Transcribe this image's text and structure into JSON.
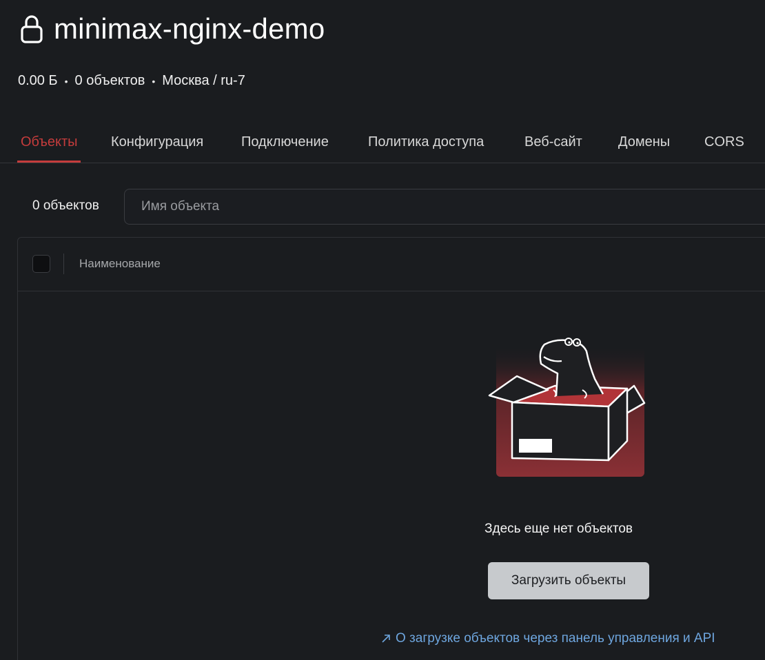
{
  "bucket": {
    "title": "minimax-nginx-demo",
    "size": "0.00 Б",
    "objects": "0 объектов",
    "location": "Москва / ru-7",
    "separator": "•"
  },
  "tabs": [
    {
      "label": "Объекты",
      "active": true
    },
    {
      "label": "Конфигурация",
      "active": false
    },
    {
      "label": "Подключение",
      "active": false
    },
    {
      "label": "Политика доступа",
      "active": false
    },
    {
      "label": "Веб-сайт",
      "active": false
    },
    {
      "label": "Домены",
      "active": false
    },
    {
      "label": "CORS",
      "active": false
    }
  ],
  "toolbar": {
    "count": "0 объектов",
    "search_placeholder": "Имя объекта"
  },
  "table": {
    "columns": [
      "Наименование"
    ]
  },
  "empty_state": {
    "message": "Здесь еще нет объектов",
    "upload_button": "Загрузить объекты",
    "help_link": "О загрузке объектов через панель управления и API"
  },
  "colors": {
    "accent": "#c53c3c",
    "background": "#1a1c1f",
    "link": "#6ea6df",
    "button": "#c7cacd"
  },
  "icons": {
    "lock": "lock-icon",
    "arrow": "arrow-up-right-icon",
    "illustration": "dino-in-box-illustration"
  }
}
